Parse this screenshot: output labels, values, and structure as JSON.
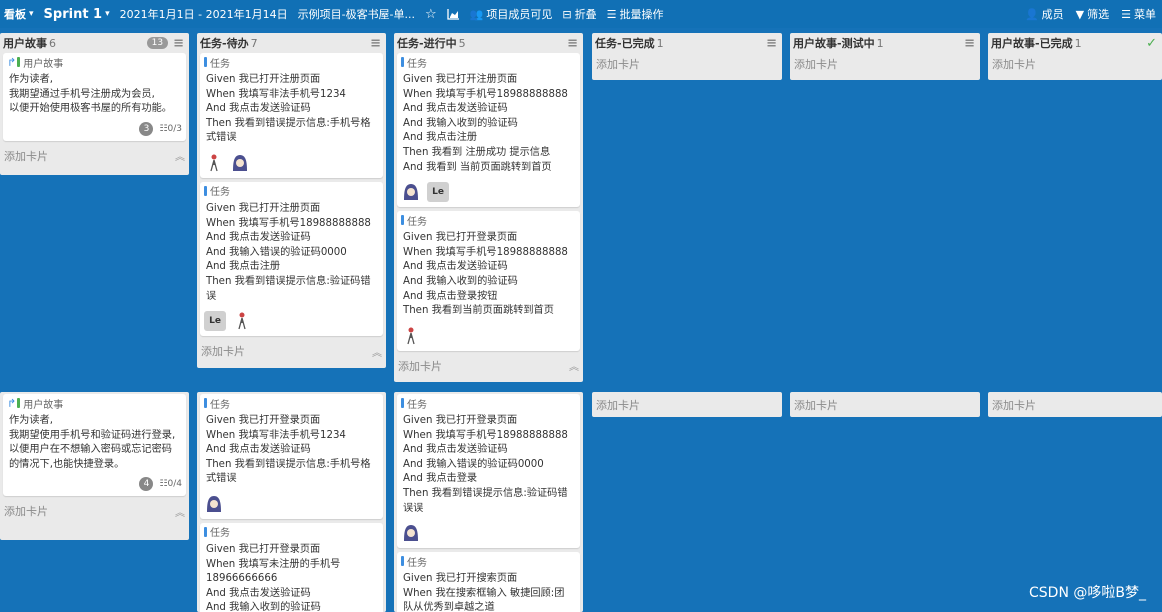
{
  "topbar": {
    "view_label": "看板",
    "sprint_label": "Sprint 1",
    "date_range": "2021年1月1日 - 2021年1月14日",
    "project_name": "示例项目-极客书屋-单...",
    "visibility": "项目成员可见",
    "fold_label": "折叠",
    "batch_label": "批量操作",
    "members_label": "成员",
    "filter_label": "筛选",
    "menu_label": "菜单"
  },
  "columns": [
    {
      "title": "用户故事",
      "count": "6",
      "badge": "13"
    },
    {
      "title": "任务-待办",
      "count": "7"
    },
    {
      "title": "任务-进行中",
      "count": "5"
    },
    {
      "title": "任务-已完成",
      "count": "1"
    },
    {
      "title": "用户故事-测试中",
      "count": "1"
    },
    {
      "title": "用户故事-已完成",
      "count": "1"
    }
  ],
  "add_card_label": "添加卡片",
  "type_story": "用户故事",
  "type_task": "任务",
  "avatar_le": "Le",
  "cards": {
    "story1": {
      "text": "作为读者,\n我期望通过手机号注册成为会员,\n以便开始使用极客书屋的所有功能。",
      "comments": "3",
      "checklist": "0/3"
    },
    "story2": {
      "text": "作为读者,\n我期望使用手机号和验证码进行登录,\n以便用户在不想输入密码或忘记密码的情况下,也能快捷登录。",
      "comments": "4",
      "checklist": "0/4"
    },
    "todo1": {
      "text": "Given 我已打开注册页面\nWhen 我填写非法手机号1234\nAnd 我点击发送验证码\nThen 我看到错误提示信息:手机号格式错误"
    },
    "todo2": {
      "text": "Given 我已打开注册页面\nWhen 我填写手机号18988888888\nAnd 我点击发送验证码\nAnd 我输入错误的验证码0000\nAnd 我点击注册\nThen 我看到错误提示信息:验证码错误"
    },
    "todo3": {
      "text": "Given 我已打开登录页面\nWhen 我填写非法手机号1234\nAnd 我点击发送验证码\nThen 我看到错误提示信息:手机号格式错误"
    },
    "todo4": {
      "text": "Given 我已打开登录页面\nWhen 我填写未注册的手机号\n18966666666\nAnd 我点击发送验证码\nAnd 我输入收到的验证码"
    },
    "doing1": {
      "text": "Given 我已打开注册页面\nWhen 我填写手机号18988888888\nAnd 我点击发送验证码\nAnd 我输入收到的验证码\nAnd 我点击注册\nThen 我看到 注册成功 提示信息\nAnd 我看到 当前页面跳转到首页"
    },
    "doing2": {
      "text": "Given 我已打开登录页面\nWhen 我填写手机号18988888888\nAnd 我点击发送验证码\nAnd 我输入收到的验证码\nAnd 我点击登录按钮\nThen 我看到当前页面跳转到首页"
    },
    "doing3": {
      "text": "Given 我已打开登录页面\nWhen 我填写手机号18988888888\nAnd 我点击发送验证码\nAnd 我输入错误的验证码0000\nAnd 我点击登录\nThen 我看到错误提示信息:验证码错误误"
    },
    "doing4": {
      "text": "Given 我已打开搜索页面\nWhen 我在搜索框输入 敏捷回顾:团队从优秀到卓越之道"
    }
  },
  "watermark": "CSDN @哆啦B梦_",
  "colors": {
    "board_bg": "#1572b8",
    "topbar_bg": "#1170b5",
    "column_bg": "#eaeaea",
    "accent": "#3d8ee0"
  }
}
